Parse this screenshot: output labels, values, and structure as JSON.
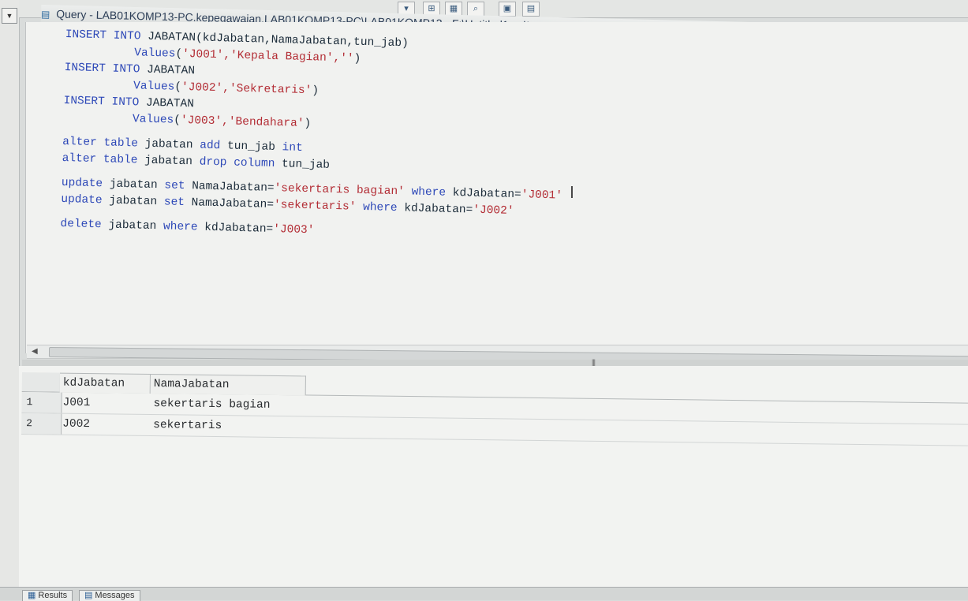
{
  "window": {
    "title": "Query - LAB01KOMP13-PC.kepegawaian.LAB01KOMP13-PC\\LAB01KOMP13 - F:\\Untitled1.sql*",
    "icon": "query-icon"
  },
  "toolbar": {
    "buttons": [
      "dropdown-arrow-icon",
      "results-to-text-icon",
      "results-to-grid-icon",
      "results-to-file-icon",
      "options-icon",
      "grid-icon"
    ]
  },
  "colors": {
    "keyword": "#2e49b8",
    "string": "#b32d35",
    "text": "#1c2c3a",
    "editor_bg": "#f1f2f0"
  },
  "editor": {
    "lines": [
      {
        "kw1": "INSERT INTO",
        "text": " JABATAN(kdJabatan,NamaJabatan,tun_jab)",
        "indent": 0
      },
      {
        "kw1": "Values",
        "text": "(",
        "str": "'J001','Kepala Bagian',''",
        "text2": ")",
        "indent": 1
      },
      {
        "kw1": "INSERT INTO",
        "text": " JABATAN",
        "indent": 0
      },
      {
        "kw1": "Values",
        "text": "(",
        "str": "'J002','Sekretaris'",
        "text2": ")",
        "indent": 1
      },
      {
        "kw1": "INSERT INTO",
        "text": " JABATAN",
        "indent": 0
      },
      {
        "kw1": "Values",
        "text": "(",
        "str": "'J003','Bendahara'",
        "text2": ")",
        "indent": 1
      },
      {
        "blank": true
      },
      {
        "kw1": "alter table",
        "text": " jabatan ",
        "kw2": "add",
        "text2": " tun_jab ",
        "kw3": "int"
      },
      {
        "kw1": "alter table",
        "text": " jabatan ",
        "kw2": "drop column",
        "text2": " tun_jab"
      },
      {
        "blank": true
      },
      {
        "kw1": "update",
        "text": " jabatan ",
        "kw2": "set",
        "text2": " NamaJabatan=",
        "str": "'sekertaris bagian'",
        "kw3": " where",
        "text3": " kdJabatan=",
        "str2": "'J001'"
      },
      {
        "kw1": "update",
        "text": " jabatan ",
        "kw2": "set",
        "text2": " NamaJabatan=",
        "str": "'sekertaris'",
        "kw3": " where",
        "text3": " kdJabatan=",
        "str2": "'J002'"
      },
      {
        "blank": true
      },
      {
        "kw1": "delete",
        "text": " jabatan ",
        "kw2": "where",
        "text2": " kdJabatan=",
        "str": "'J003'"
      }
    ]
  },
  "results": {
    "columns": [
      "kdJabatan",
      "NamaJabatan"
    ],
    "rows": [
      {
        "num": "1",
        "kdJabatan": "J001",
        "NamaJabatan": "sekertaris bagian"
      },
      {
        "num": "2",
        "kdJabatan": "J002",
        "NamaJabatan": "sekertaris"
      }
    ]
  },
  "bottom_tabs": {
    "results_label": "Results",
    "messages_label": "Messages"
  }
}
